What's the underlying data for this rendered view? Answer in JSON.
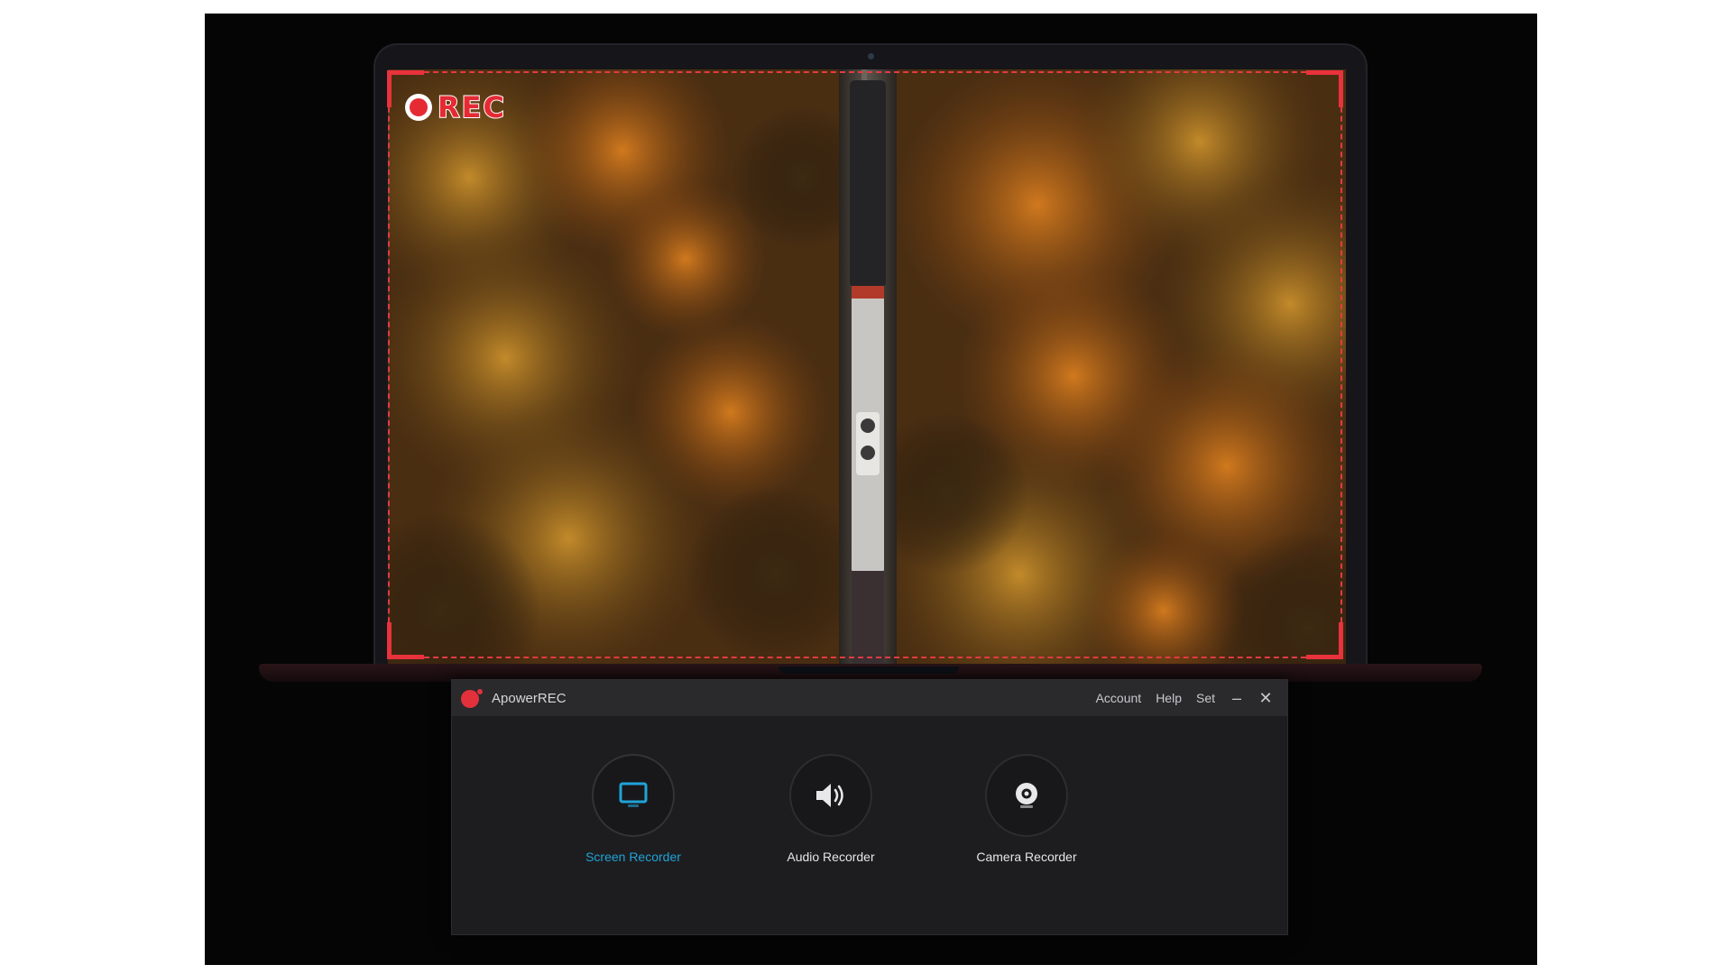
{
  "preview": {
    "rec_label": "REC"
  },
  "app": {
    "title": "ApowerREC",
    "menu": {
      "account": "Account",
      "help": "Help",
      "set": "Set"
    },
    "window_controls": {
      "minimize": "–",
      "close": "✕"
    },
    "modes": [
      {
        "label": "Screen Recorder",
        "icon": "monitor-icon",
        "active": true
      },
      {
        "label": "Audio Recorder",
        "icon": "speaker-icon",
        "active": false
      },
      {
        "label": "Camera Recorder",
        "icon": "webcam-icon",
        "active": false
      }
    ]
  },
  "colors": {
    "accent": "#1fa3d8",
    "record_red": "#e52a34",
    "app_background": "#1d1d1f",
    "titlebar": "#2a2a2d"
  }
}
